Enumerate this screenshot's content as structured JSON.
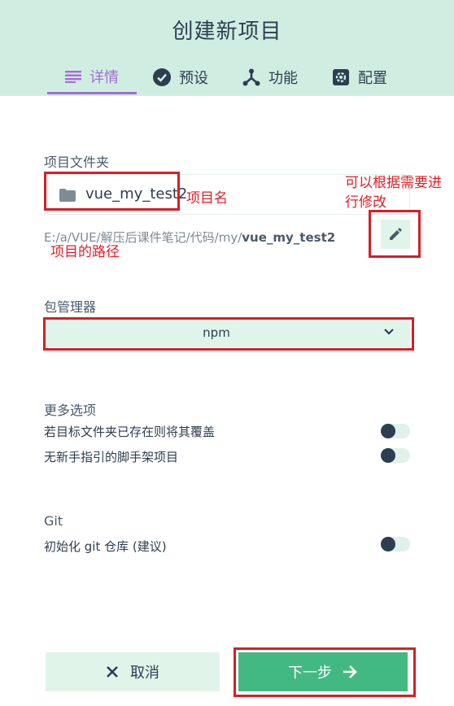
{
  "header": {
    "title": "创建新项目"
  },
  "tabs": [
    {
      "label": "详情",
      "active": true
    },
    {
      "label": "预设",
      "active": false
    },
    {
      "label": "功能",
      "active": false
    },
    {
      "label": "配置",
      "active": false
    }
  ],
  "folder": {
    "label": "项目文件夹",
    "value": "vue_my_test2"
  },
  "path": {
    "prefix": "E:/a/VUE/解压后课件笔记/代码/my/",
    "name": "vue_my_test2"
  },
  "package_manager": {
    "label": "包管理器",
    "selected": "npm"
  },
  "more_options": {
    "label": "更多选项",
    "items": [
      {
        "label": "若目标文件夹已存在则将其覆盖",
        "enabled": false
      },
      {
        "label": "无新手指引的脚手架项目",
        "enabled": false
      }
    ]
  },
  "git": {
    "label": "Git",
    "option_label": "初始化 git 仓库 (建议)",
    "enabled": false
  },
  "actions": {
    "cancel_label": "取消",
    "next_label": "下一步"
  },
  "annotations": {
    "project_name": "项目名",
    "modify_line1": "可以根据需要进",
    "modify_line2": "行修改",
    "project_path": "项目的路径"
  },
  "colors": {
    "accent": "#42b983",
    "header_bg": "#cfeee1",
    "active_tab": "#a66bd6",
    "annotation": "#d51f26"
  }
}
